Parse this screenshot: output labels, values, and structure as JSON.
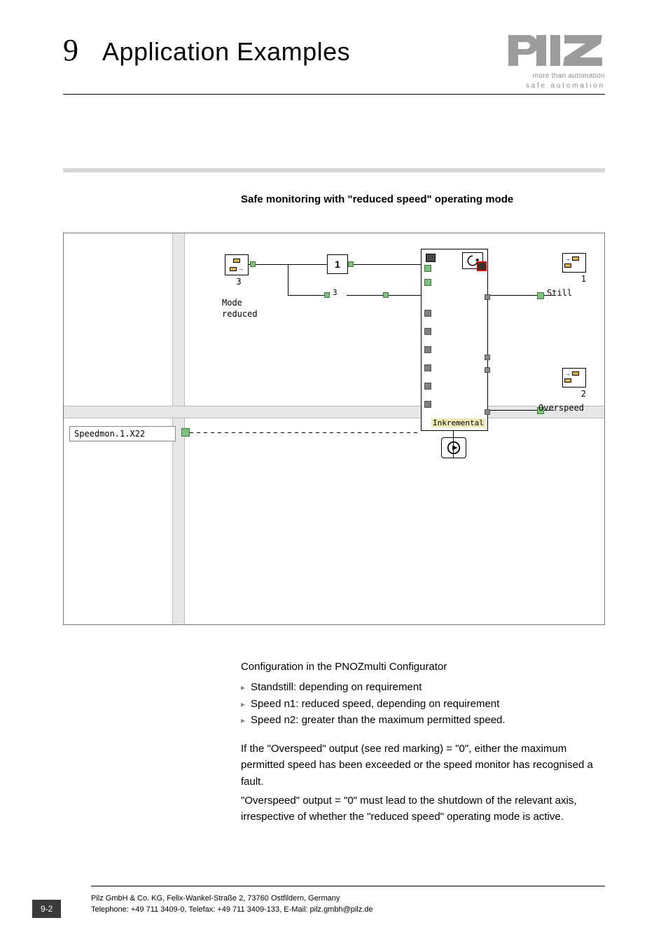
{
  "header": {
    "chapter_number": "9",
    "chapter_title": "Application Examples",
    "logo_sub_line1": "more than automation",
    "logo_sub_line2": "safe automation"
  },
  "section_heading": "Safe monitoring with \"reduced speed\" operating mode",
  "diagram": {
    "mode_block": {
      "num": "3",
      "label_line1": "Mode",
      "label_line2": "reduced"
    },
    "and_block": {
      "label": "1",
      "pin_label": "3"
    },
    "speed_block": {
      "inkremental_label": "Inkremental"
    },
    "out1": {
      "num": "1",
      "label": "Still"
    },
    "out2": {
      "num": "2",
      "label": "Overspeed"
    },
    "speedmon_label": "Speedmon.1.X22"
  },
  "body": {
    "config_title": "Configuration in the PNOZmulti Configurator",
    "bullets": [
      "Standstill: depending on requirement",
      "Speed n1: reduced speed, depending on requirement",
      "Speed n2: greater than the maximum permitted speed."
    ],
    "para1": "If the \"Overspeed\" output (see red marking) = \"0\", either the maximum permitted speed has been exceeded or the speed monitor has recognised a fault.",
    "para2": "\"Overspeed\" output = \"0\" must lead to the shutdown of the relevant axis, irrespective of whether the \"reduced speed\" operating mode is active."
  },
  "footer": {
    "page_num": "9-2",
    "line1": "Pilz GmbH & Co. KG, Felix-Wankel-Straße 2, 73760 Ostfildern, Germany",
    "line2": "Telephone: +49 711 3409-0, Telefax: +49 711 3409-133, E-Mail: pilz.gmbh@pilz.de"
  }
}
